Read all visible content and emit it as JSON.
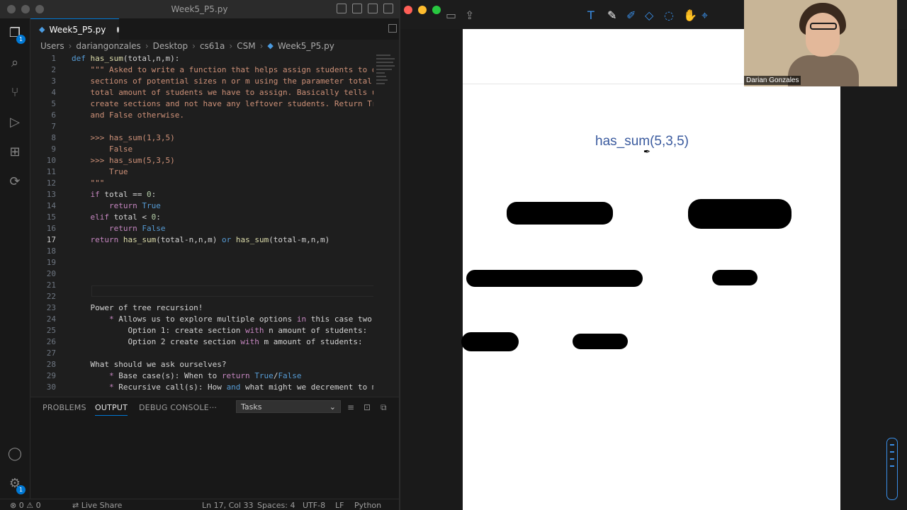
{
  "window_title": "Week5_P5.py",
  "tab": {
    "label": "Week5_P5.py"
  },
  "breadcrumb": [
    "Users",
    "dariangonzales",
    "Desktop",
    "cs61a",
    "CSM",
    "Week5_P5.py"
  ],
  "code_lines": [
    {
      "n": "1",
      "html": "<span class=\"kwb\">def</span> <span class=\"fn\">has_sum</span>(total,n,m):"
    },
    {
      "n": "2",
      "html": "    <span class=\"str\">\"\"\" Asked to write a function that helps assign students to di</span>"
    },
    {
      "n": "3",
      "html": "    <span class=\"str\">sections of potential sizes n or m using the parameter total a</span>"
    },
    {
      "n": "4",
      "html": "    <span class=\"str\">total amount of students we have to assign. Basically tells us</span>"
    },
    {
      "n": "5",
      "html": "    <span class=\"str\">create sections and not have any leftover students. Return Tru</span>"
    },
    {
      "n": "6",
      "html": "    <span class=\"str\">and False otherwise.</span>"
    },
    {
      "n": "7",
      "html": ""
    },
    {
      "n": "8",
      "html": "    <span class=\"str\">&gt;&gt;&gt; has_sum(1,3,5)</span>"
    },
    {
      "n": "9",
      "html": "        <span class=\"str\">False</span>"
    },
    {
      "n": "10",
      "html": "    <span class=\"str\">&gt;&gt;&gt; has_sum(5,3,5)</span>"
    },
    {
      "n": "11",
      "html": "        <span class=\"str\">True</span>"
    },
    {
      "n": "12",
      "html": "    <span class=\"str\">\"\"\"</span>"
    },
    {
      "n": "13",
      "html": "    <span class=\"kw\">if</span> total == <span class=\"num\">0</span>:"
    },
    {
      "n": "14",
      "html": "        <span class=\"kw\">return</span> <span class=\"kwb\">True</span>"
    },
    {
      "n": "15",
      "html": "    <span class=\"kw\">elif</span> total &lt; <span class=\"num\">0</span>:"
    },
    {
      "n": "16",
      "html": "        <span class=\"kw\">return</span> <span class=\"kwb\">False</span>"
    },
    {
      "n": "17",
      "html": "    <span class=\"kw\">return</span> <span class=\"fn\">has_sum</span>(total-n,n,m) <span class=\"kwb\">or</span> <span class=\"fn\">has_sum</span>(total-m,n,m)"
    },
    {
      "n": "18",
      "html": ""
    },
    {
      "n": "19",
      "html": ""
    },
    {
      "n": "20",
      "html": ""
    },
    {
      "n": "21",
      "html": ""
    },
    {
      "n": "22",
      "html": ""
    },
    {
      "n": "23",
      "html": "    Power of tree recursion!"
    },
    {
      "n": "24",
      "html": "        <span class=\"kw\">*</span> Allows us to explore multiple options <span class=\"kw\">in</span> this case two o"
    },
    {
      "n": "25",
      "html": "            Option 1: create section <span class=\"kw\">with</span> n amount of students:"
    },
    {
      "n": "26",
      "html": "            Option 2 create section <span class=\"kw\">with</span> m amount of students:"
    },
    {
      "n": "27",
      "html": ""
    },
    {
      "n": "28",
      "html": "    What should we ask ourselves?"
    },
    {
      "n": "29",
      "html": "        <span class=\"kw\">*</span> Base case(s): When to <span class=\"kw\">return</span> <span class=\"kwb\">True</span>/<span class=\"kwb\">False</span>"
    },
    {
      "n": "30",
      "html": "        <span class=\"kw\">*</span> Recursive call(s): How <span class=\"kwb\">and</span> what might we decrement to ma"
    }
  ],
  "panel": {
    "tabs": [
      "PROBLEMS",
      "OUTPUT",
      "DEBUG CONSOLE",
      "···"
    ],
    "active_tab": "OUTPUT",
    "select_value": "Tasks"
  },
  "status": {
    "problems": "⊗ 0 ⚠ 0",
    "live_share": "Live Share",
    "position": "Ln 17, Col 33",
    "spaces": "Spaces: 4",
    "encoding": "UTF-8",
    "eol": "LF",
    "language": "Python"
  },
  "whiteboard": {
    "text": "has_sum(5,3,5)"
  },
  "webcam": {
    "name": "Darian Gonzales"
  },
  "colors": {
    "accent": "#0078d4",
    "board_tools": "#3a8ee6",
    "board_text": "#3a5a9e"
  }
}
